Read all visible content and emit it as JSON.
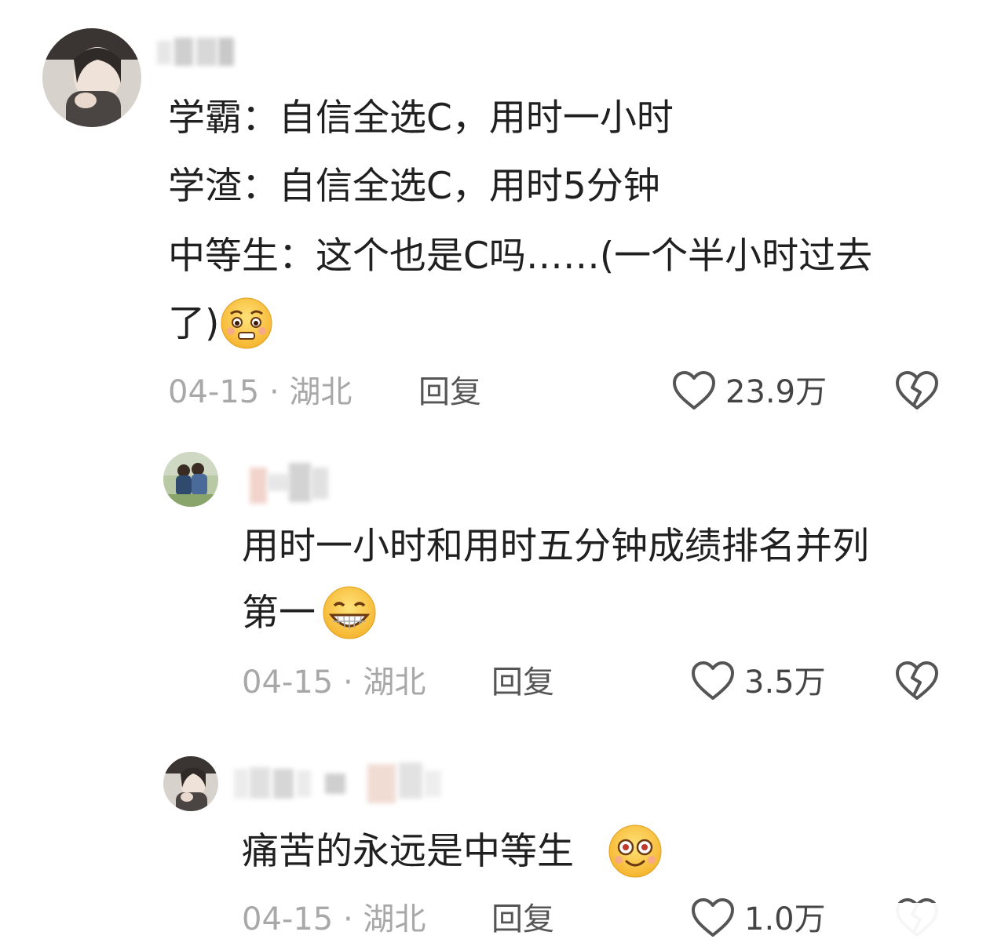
{
  "comments": [
    {
      "lines": [
        "学霸：自信全选C，用时一小时",
        "学渣：自信全选C，用时5分钟",
        "中等生：这个也是C吗……(一个半小时过去",
        "了)"
      ],
      "emoji": "worried-face-emoji",
      "date_location": "04-15 · 湖北",
      "reply_label": "回复",
      "likes": "23.9万"
    },
    {
      "lines": [
        "用时一小时和用时五分钟成绩排名并列",
        "第一"
      ],
      "emoji": "grinning-face-emoji",
      "date_location": "04-15 · 湖北",
      "reply_label": "回复",
      "likes": "3.5万"
    },
    {
      "lines": [
        "痛苦的永远是中等生"
      ],
      "emoji": "smiling-face-emoji",
      "date_location": "04-15 · 湖北",
      "reply_label": "回复",
      "likes": "1.0万"
    }
  ],
  "icons": {
    "like": "heart-outline-icon",
    "dislike": "broken-heart-icon"
  },
  "colors": {
    "text": "#202020",
    "meta": "#a8a8a8",
    "icon": "#555555"
  }
}
